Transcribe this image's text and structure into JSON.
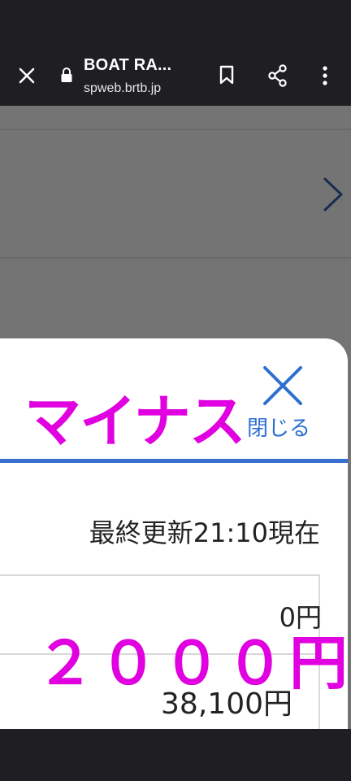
{
  "browser": {
    "title": "BOAT RA...",
    "url": "spweb.brtb.jp"
  },
  "sheet": {
    "close_label": "閉じる",
    "updated": "最終更新21:10現在",
    "rows": [
      {
        "value": "0円"
      },
      {
        "value": "38,100円"
      }
    ]
  },
  "overlay_text": {
    "minus": "マイナス",
    "amount": "２０００円"
  },
  "colors": {
    "accent_blue": "#3a6fd0",
    "overlay_magenta": "#e000e0"
  }
}
